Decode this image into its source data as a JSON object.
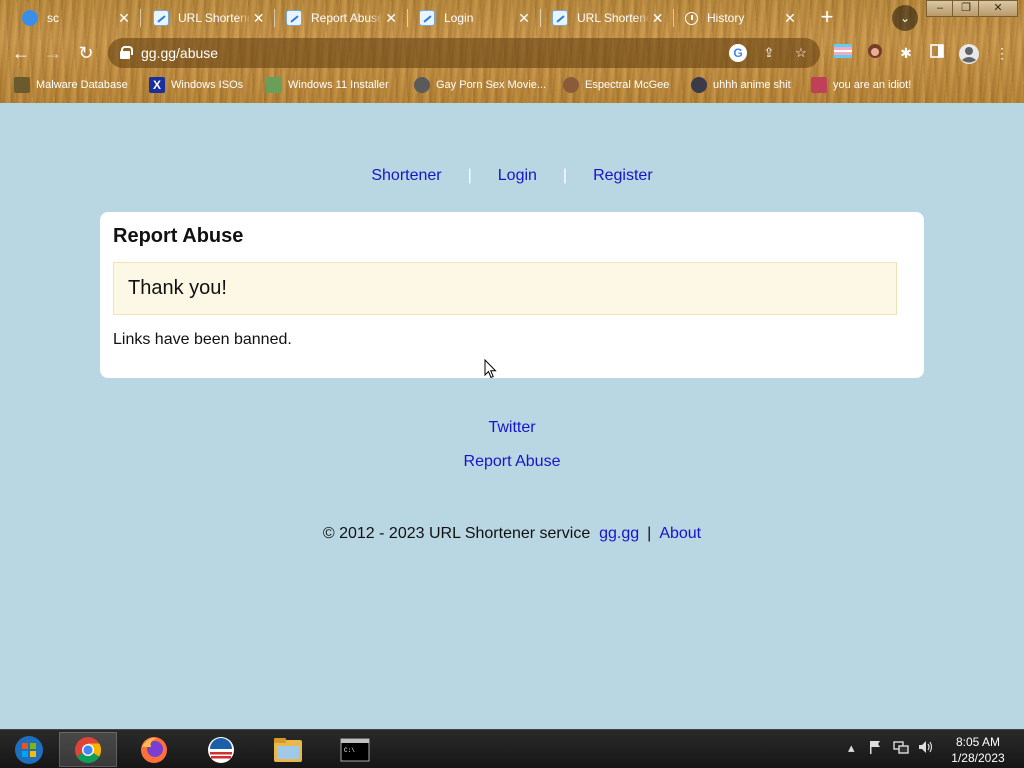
{
  "browser": {
    "tabs": [
      {
        "title": "sc",
        "icon": "sc-favicon-icon"
      },
      {
        "title": "URL Shortener",
        "icon": "url-shortener-favicon-icon"
      },
      {
        "title": "Report Abuse",
        "icon": "url-shortener-favicon-icon"
      },
      {
        "title": "Login",
        "icon": "url-shortener-favicon-icon"
      },
      {
        "title": "URL Shortener",
        "icon": "url-shortener-favicon-icon"
      },
      {
        "title": "History",
        "icon": "history-icon"
      }
    ],
    "address": "gg.gg/abuse",
    "bookmarks": [
      {
        "label": "Malware Database",
        "color": "#6b5a2e"
      },
      {
        "label": "Windows ISOs",
        "color": "#1a2fa0"
      },
      {
        "label": "Windows 11 Installer",
        "color": "#6a9f5a"
      },
      {
        "label": "Gay Porn Sex Movie...",
        "color": "#5a5a5a"
      },
      {
        "label": "Espectral McGee",
        "color": "#8a5a3a"
      },
      {
        "label": "uhhh anime shit",
        "color": "#3a3a4a"
      },
      {
        "label": "you are an idiot!",
        "color": "#c0405a"
      }
    ]
  },
  "nav": {
    "shortener": "Shortener",
    "login": "Login",
    "register": "Register",
    "separator": "|"
  },
  "card": {
    "title": "Report Abuse",
    "alert": "Thank you!",
    "message": "Links have been banned."
  },
  "footer": {
    "twitter": "Twitter",
    "report_abuse": "Report Abuse",
    "copyright": "© 2012 - 2023 URL Shortener service",
    "site_link": "gg.gg",
    "separator": "|",
    "about": "About"
  },
  "taskbar": {
    "time": "8:05 AM",
    "date": "1/28/2023"
  },
  "colors": {
    "page_background": "#b9d6e3",
    "link": "#1515c9",
    "alert_background": "#fdf8e6"
  }
}
